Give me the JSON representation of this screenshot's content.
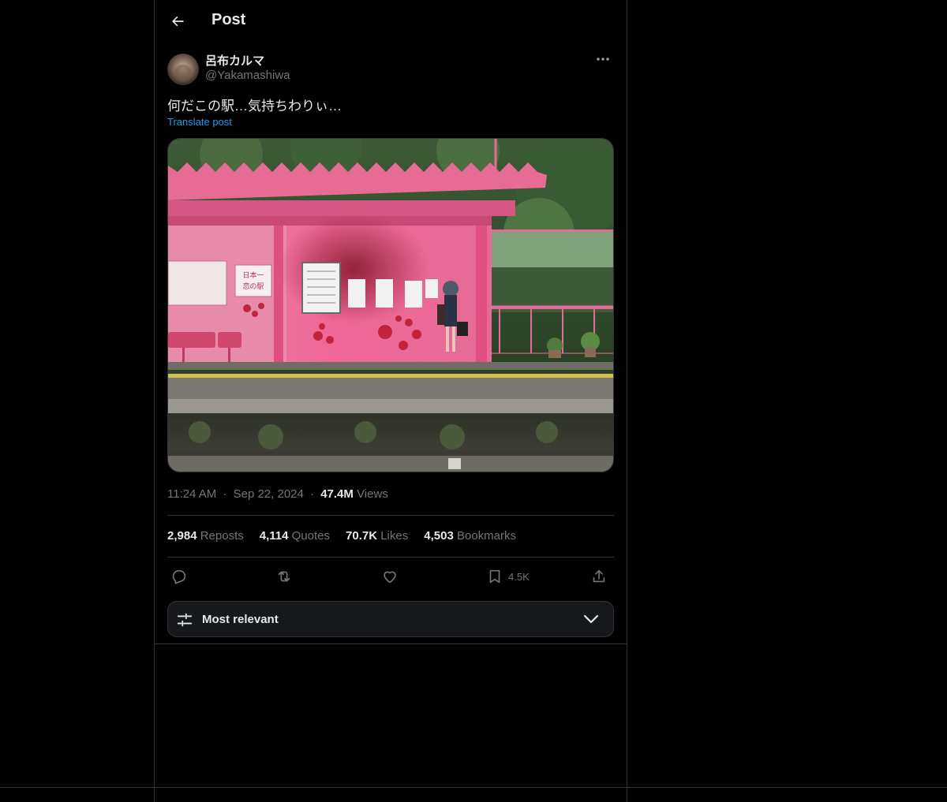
{
  "header": {
    "title": "Post"
  },
  "author": {
    "display_name": "呂布カルマ",
    "handle": "@Yakamashiwa"
  },
  "post": {
    "text": "何だこの駅…気持ちわりぃ…",
    "translate_label": "Translate post",
    "time": "11:24 AM",
    "date": "Sep 22, 2024",
    "views_count": "47.4M",
    "views_label": "Views",
    "separator": "·",
    "media_sign_text": "日本一 恋の駅"
  },
  "stats": [
    {
      "count": "2,984",
      "label": "Reposts"
    },
    {
      "count": "4,114",
      "label": "Quotes"
    },
    {
      "count": "70.7K",
      "label": "Likes"
    },
    {
      "count": "4,503",
      "label": "Bookmarks"
    }
  ],
  "actions": {
    "bookmark_count": "4.5K"
  },
  "sort": {
    "label": "Most relevant"
  },
  "colors": {
    "link": "#1d9bf0",
    "muted": "#71767b",
    "text": "#e7e9ea",
    "border": "#2f3336"
  },
  "icons": [
    "back-arrow-icon",
    "more-icon",
    "reply-icon",
    "repost-icon",
    "like-icon",
    "bookmark-icon",
    "share-icon",
    "sliders-icon",
    "chevron-down-icon"
  ]
}
